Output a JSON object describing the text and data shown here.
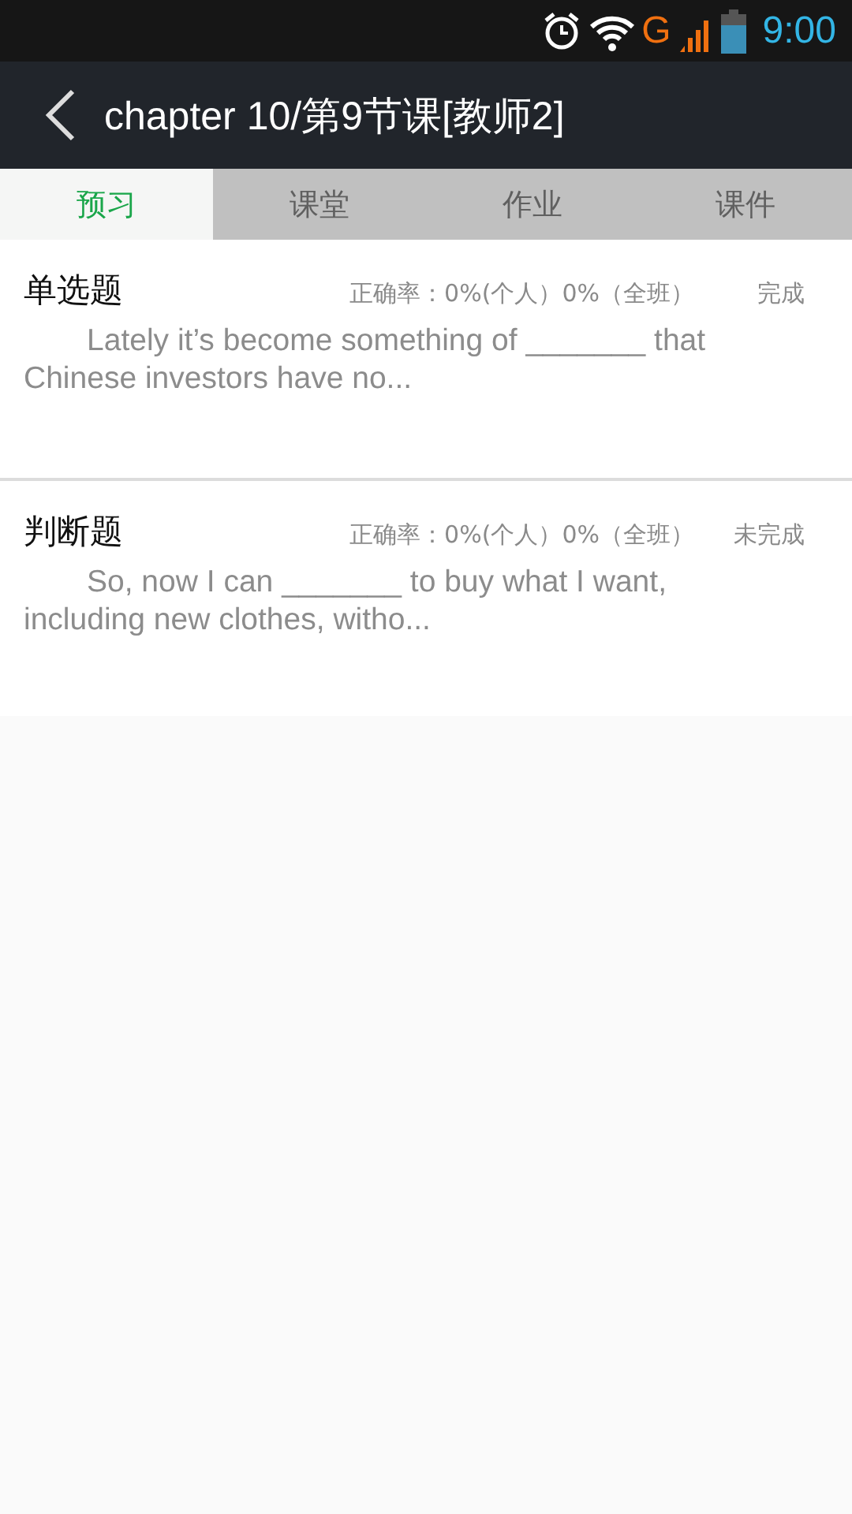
{
  "status_bar": {
    "network": "G",
    "time": "9:00"
  },
  "header": {
    "title": "chapter 10/第9节课[教师2]"
  },
  "tabs": [
    {
      "label": "预习",
      "selected": true
    },
    {
      "label": "课堂",
      "selected": false
    },
    {
      "label": "作业",
      "selected": false
    },
    {
      "label": "课件",
      "selected": false
    }
  ],
  "questions": [
    {
      "type": "单选题",
      "accuracy": "正确率：0%(个人）0%（全班）",
      "status": "完成",
      "excerpt": "Lately it’s become something of _______ that Chinese investors have no..."
    },
    {
      "type": "判断题",
      "accuracy": "正确率：0%(个人）0%（全班）",
      "status": "未完成",
      "excerpt": "So, now I can _______ to buy what I want, including new clothes, witho..."
    }
  ]
}
